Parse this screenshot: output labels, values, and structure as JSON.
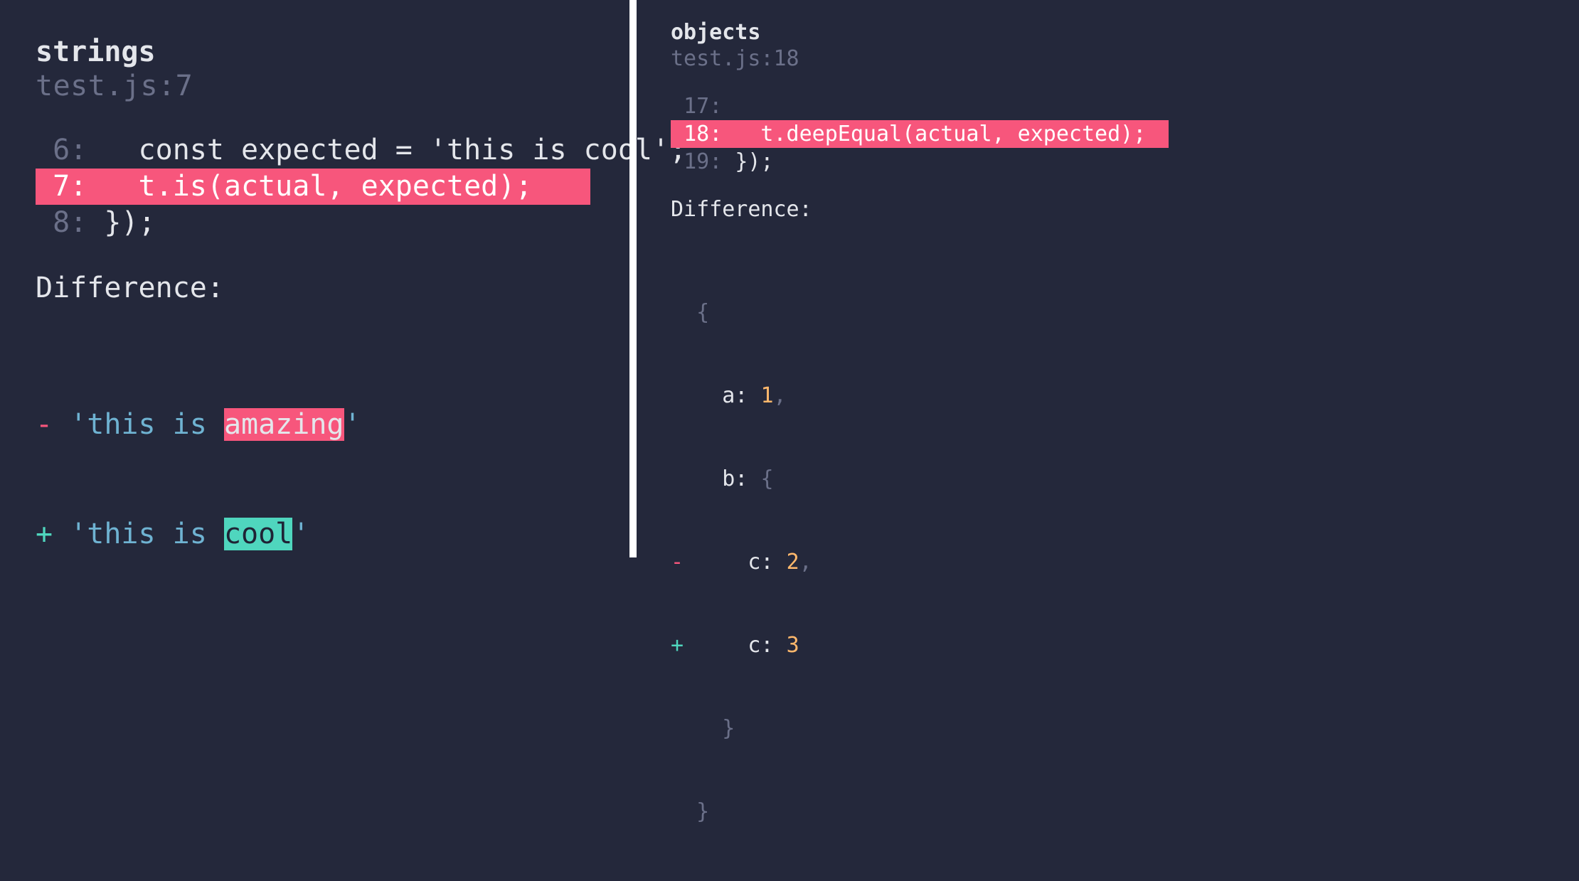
{
  "left": {
    "title": "strings",
    "location": "test.js:7",
    "lines": [
      {
        "num": "6",
        "text": "  const expected = 'this is cool';",
        "hl": false
      },
      {
        "num": "7",
        "text": "  t.is(actual, expected);",
        "hl": true
      },
      {
        "num": "8",
        "text": "});",
        "hl": false
      }
    ],
    "diff_label": "Difference:",
    "diff_minus": {
      "sign": "-",
      "pre": "'this is ",
      "word": "amazing",
      "post": "'"
    },
    "diff_plus": {
      "sign": "+",
      "pre": "'this is ",
      "word": "cool",
      "post": "'"
    }
  },
  "right": {
    "title": "objects",
    "location": "test.js:18",
    "lines": [
      {
        "num": "17",
        "text": "",
        "hl": false
      },
      {
        "num": "18",
        "text": "  t.deepEqual(actual, expected);",
        "hl": true
      },
      {
        "num": "19",
        "text": "});",
        "hl": false
      }
    ],
    "diff_label": "Difference:",
    "obj": {
      "open": "{",
      "a_key": "a:",
      "a_val": "1",
      "a_comma": ",",
      "b_key": "b:",
      "b_open": "{",
      "minus_sign": "-",
      "c1_key": "c:",
      "c1_val": "2",
      "c1_comma": ",",
      "plus_sign": "+",
      "c2_key": "c:",
      "c2_val": "3",
      "b_close": "}",
      "close": "}"
    }
  }
}
